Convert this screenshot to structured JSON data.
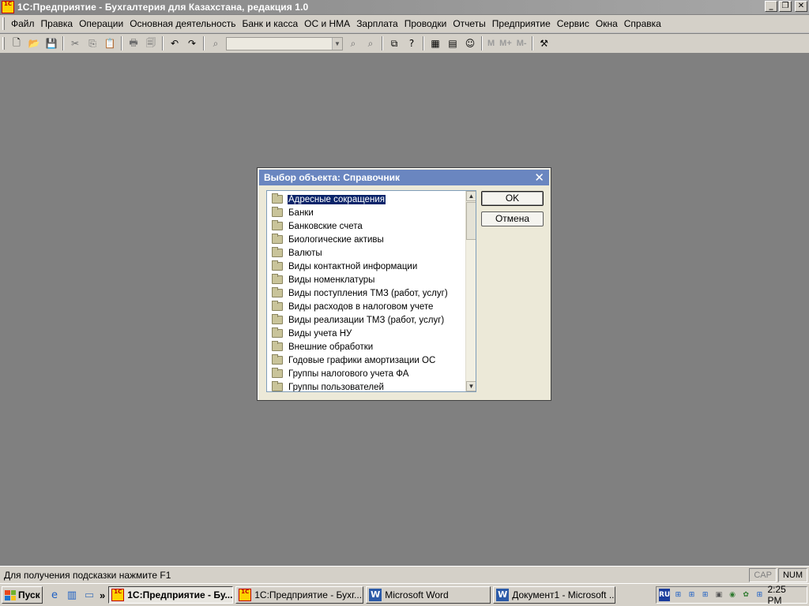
{
  "window": {
    "title": "1С:Предприятие - Бухгалтерия для Казахстана, редакция 1.0",
    "app_icon_text": "1C",
    "minimize": "_",
    "restore": "❐",
    "close": "✕"
  },
  "menu": {
    "items": [
      "Файл",
      "Правка",
      "Операции",
      "Основная деятельность",
      "Банк и касса",
      "ОС и НМА",
      "Зарплата",
      "Проводки",
      "Отчеты",
      "Предприятие",
      "Сервис",
      "Окна",
      "Справка"
    ]
  },
  "toolbar": {
    "search_value": "",
    "m_label": "M",
    "mplus_label": "M+",
    "mminus_label": "M-"
  },
  "dialog": {
    "title": "Выбор объекта: Справочник",
    "close": "✕",
    "ok_label": "OK",
    "cancel_label": "Отмена",
    "selected_index": 0,
    "items": [
      "Адресные сокращения",
      "Банки",
      "Банковские счета",
      "Биологические активы",
      "Валюты",
      "Виды контактной информации",
      "Виды номенклатуры",
      "Виды поступления ТМЗ (работ, услуг)",
      "Виды расходов в налоговом учете",
      "Виды реализации ТМЗ (работ, услуг)",
      "Виды учета НУ",
      "Внешние обработки",
      "Годовые графики амортизации ОС",
      "Группы налогового учета ФА",
      "Группы пользователей"
    ]
  },
  "statusbar": {
    "hint": "Для получения подсказки нажмите F1",
    "cap": "CAP",
    "num": "NUM"
  },
  "taskbar": {
    "start_label": "Пуск",
    "tasks": [
      {
        "label": "1С:Предприятие - Бу...",
        "icon": "1c-icon",
        "active": true
      },
      {
        "label": "1С:Предприятие - Бухг...",
        "icon": "1c-icon",
        "active": false
      },
      {
        "label": "Microsoft Word",
        "icon": "word-icon",
        "active": false
      },
      {
        "label": "Документ1 - Microsoft ...",
        "icon": "word-icon",
        "active": false
      }
    ],
    "lang": "RU",
    "clock": "2:25 PM"
  },
  "colors": {
    "workspace": "#808080",
    "dialog_title": "#6a86c0",
    "selection": "#0a246a"
  }
}
